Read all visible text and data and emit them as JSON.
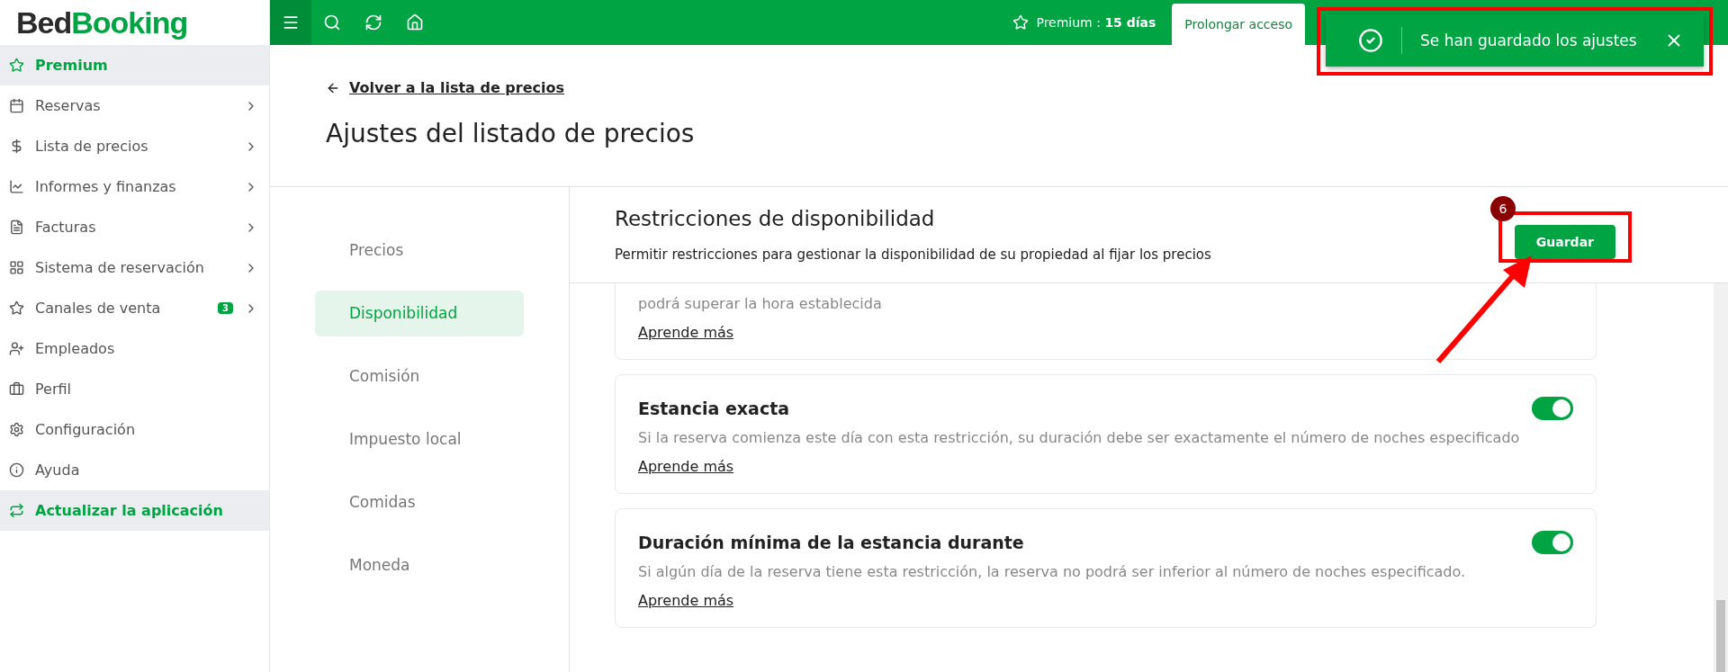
{
  "logo": {
    "part1": "Bed",
    "part2": "Booking"
  },
  "sidebar": {
    "items": [
      {
        "label": "Premium",
        "highlighted": true,
        "chevron": false
      },
      {
        "label": "Reservas",
        "highlighted": false,
        "chevron": true
      },
      {
        "label": "Lista de precios",
        "highlighted": false,
        "chevron": true
      },
      {
        "label": "Informes y finanzas",
        "highlighted": false,
        "chevron": true
      },
      {
        "label": "Facturas",
        "highlighted": false,
        "chevron": true
      },
      {
        "label": "Sistema de reservación",
        "highlighted": false,
        "chevron": true
      },
      {
        "label": "Canales de venta",
        "highlighted": false,
        "chevron": true,
        "badge": "3"
      },
      {
        "label": "Empleados",
        "highlighted": false,
        "chevron": false
      },
      {
        "label": "Perfil",
        "highlighted": false,
        "chevron": false
      },
      {
        "label": "Configuración",
        "highlighted": false,
        "chevron": false
      },
      {
        "label": "Ayuda",
        "highlighted": false,
        "chevron": false
      },
      {
        "label": "Actualizar la aplicación",
        "highlighted": true,
        "chevron": false
      }
    ]
  },
  "topbar": {
    "premium_label": "Premium : ",
    "premium_days": "15 días",
    "extend_button": "Prolongar acceso"
  },
  "toast": {
    "message": "Se han guardado los ajustes"
  },
  "back_link": "Volver a la lista de precios",
  "page_title": "Ajustes del listado de precios",
  "tabs": [
    {
      "label": "Precios",
      "selected": false
    },
    {
      "label": "Disponibilidad",
      "selected": true
    },
    {
      "label": "Comisión",
      "selected": false
    },
    {
      "label": "Impuesto local",
      "selected": false
    },
    {
      "label": "Comidas",
      "selected": false
    },
    {
      "label": "Moneda",
      "selected": false
    }
  ],
  "section": {
    "title": "Restricciones de disponibilidad",
    "description": "Permitir restricciones para gestionar la disponibilidad de su propiedad al fijar los precios",
    "save_button": "Guardar"
  },
  "cards": [
    {
      "description": "podrá superar la hora establecida",
      "link": "Aprende más"
    },
    {
      "title": "Estancia exacta",
      "on": true,
      "description": "Si la reserva comienza este día con esta restricción, su duración debe ser exactamente el número de noches especificado",
      "link": "Aprende más"
    },
    {
      "title": "Duración mínima de la estancia durante",
      "on": true,
      "description": "Si algún día de la reserva tiene esta restricción, la reserva no podrá ser inferior al número de noches especificado.",
      "link": "Aprende más"
    }
  ],
  "annotation": {
    "step": "6"
  }
}
